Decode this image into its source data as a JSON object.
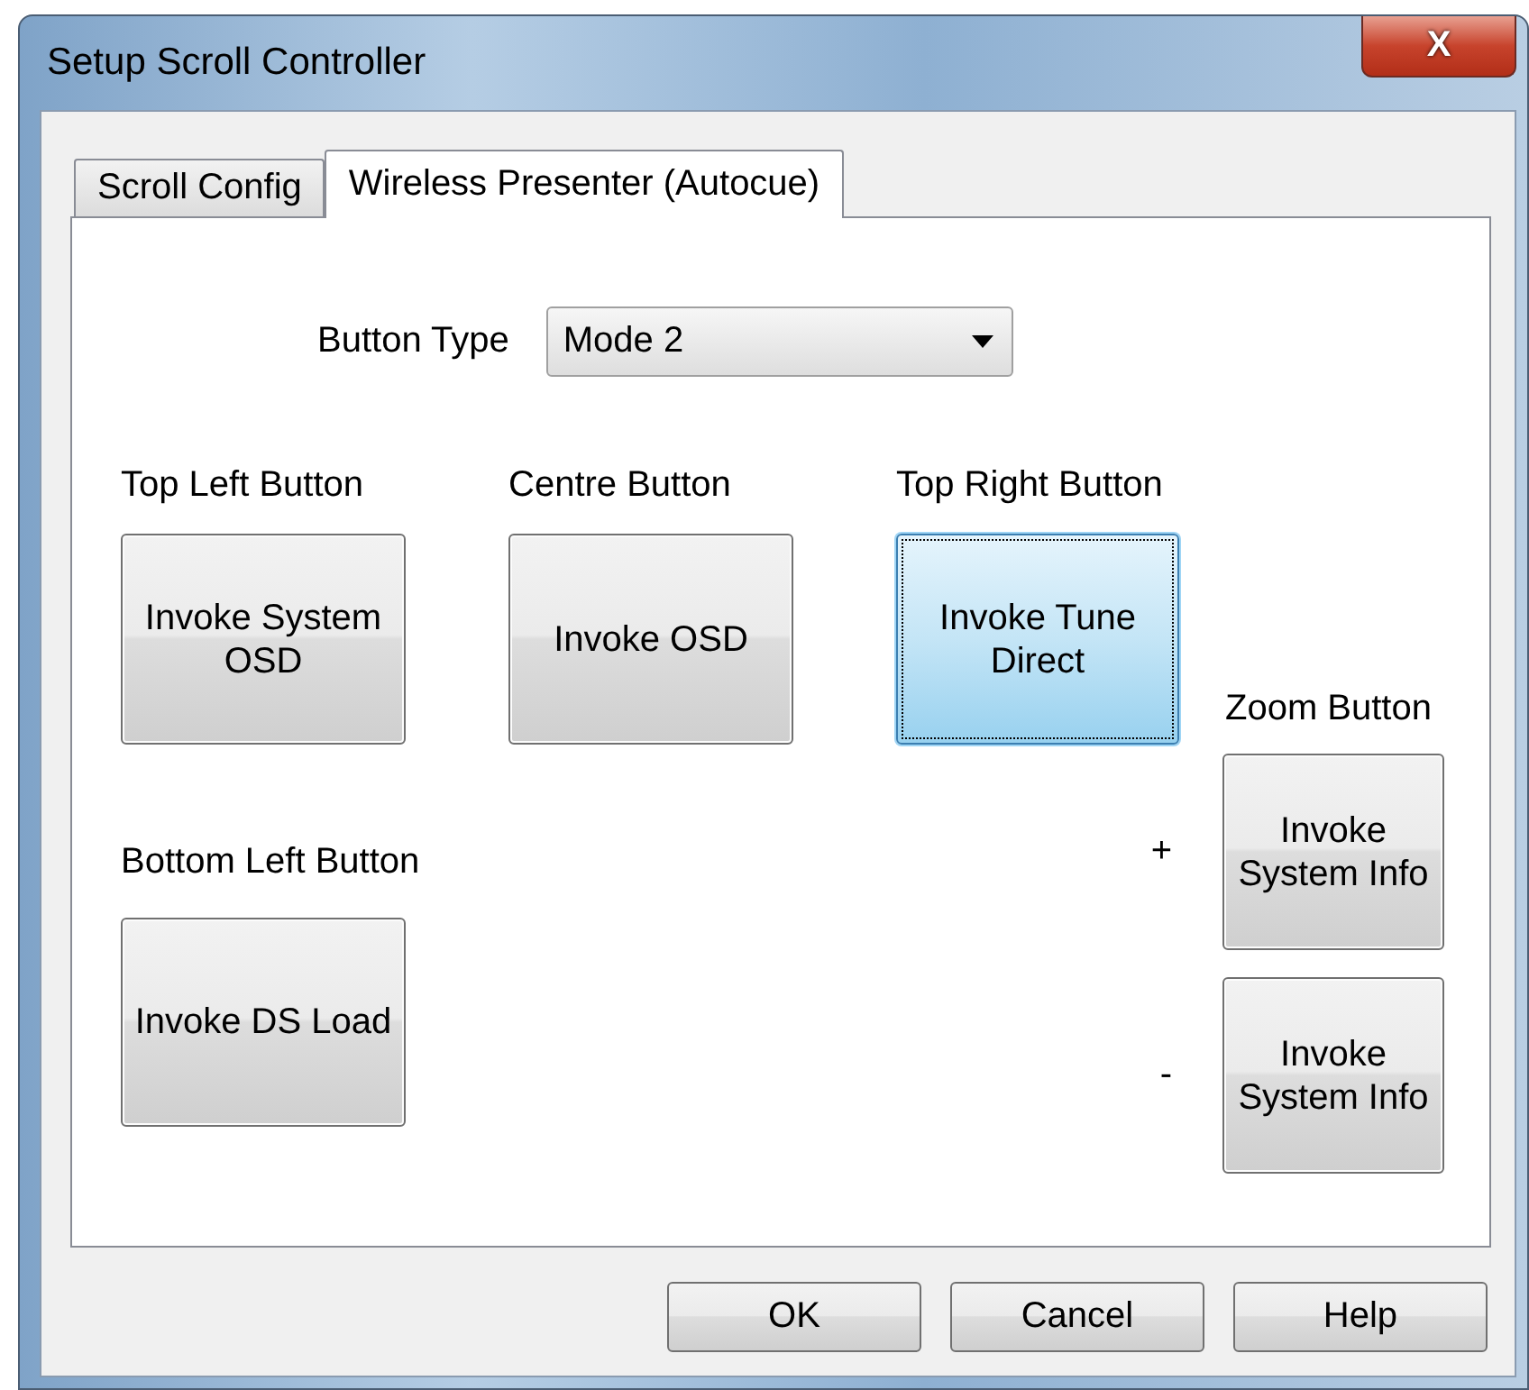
{
  "window": {
    "title": "Setup Scroll Controller",
    "close": "X"
  },
  "tabs": [
    {
      "label": "Scroll Config",
      "selected": false
    },
    {
      "label": "Wireless Presenter (Autocue)",
      "selected": true
    }
  ],
  "button_type": {
    "label": "Button Type",
    "value": "Mode 2"
  },
  "buttons": [
    {
      "label": "Top Left Button",
      "action": "Invoke System OSD",
      "focused": false
    },
    {
      "label": "Centre Button",
      "action": "Invoke OSD",
      "focused": false
    },
    {
      "label": "Top Right Button",
      "action": "Invoke Tune Direct",
      "focused": true
    },
    {
      "label": "Bottom Left Button",
      "action": "Invoke DS Load",
      "focused": false
    }
  ],
  "zoom": {
    "label": "Zoom Button",
    "steps": [
      {
        "sign": "+",
        "action": "Invoke System Info",
        "focused": false
      },
      {
        "sign": "-",
        "action": "Invoke System Info",
        "focused": false
      }
    ]
  },
  "dialog_buttons": [
    "OK",
    "Cancel",
    "Help"
  ]
}
